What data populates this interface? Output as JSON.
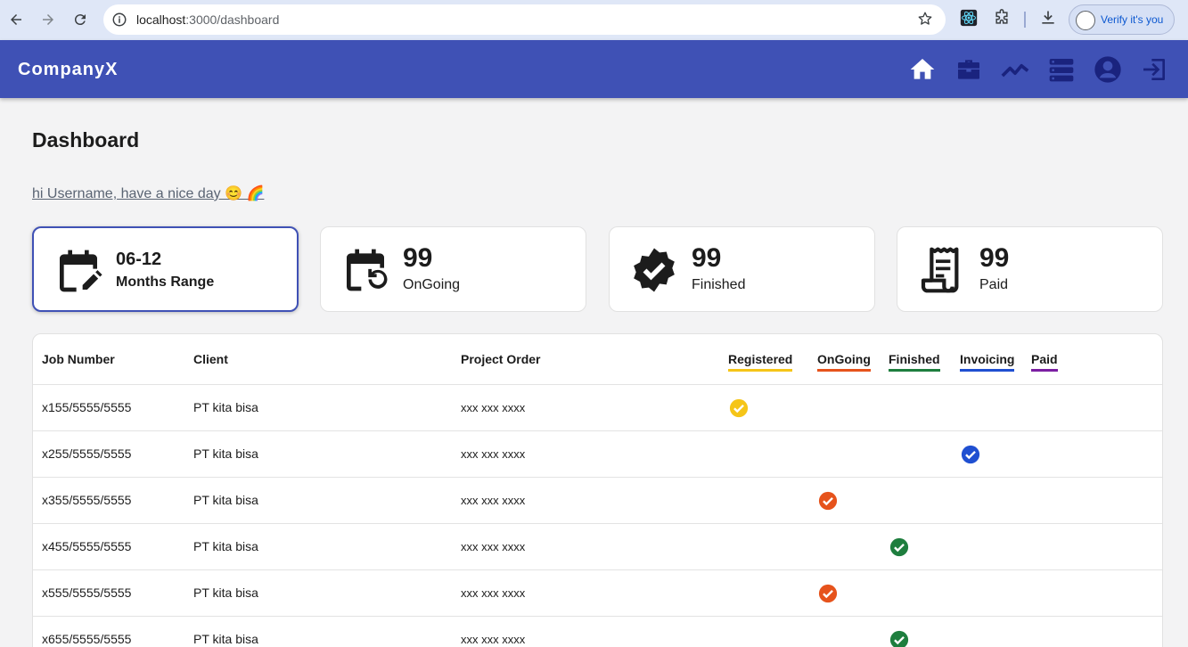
{
  "browser": {
    "url_host": "localhost",
    "url_path": ":3000/dashboard",
    "profile_label": "Verify it's you"
  },
  "appbar": {
    "brand": "CompanyX",
    "icons": [
      "home-icon",
      "briefcase-icon",
      "trending-icon",
      "list-icon",
      "account-icon",
      "logout-icon"
    ]
  },
  "page": {
    "title": "Dashboard",
    "greeting": "hi Username, have a nice day 😊 🌈"
  },
  "cards": [
    {
      "value": "06-12",
      "label": "Months Range",
      "icon": "calendar-edit-icon"
    },
    {
      "value": "99",
      "label": "OnGoing",
      "icon": "calendar-clock-icon"
    },
    {
      "value": "99",
      "label": "Finished",
      "icon": "verified-icon"
    },
    {
      "value": "99",
      "label": "Paid",
      "icon": "receipt-icon"
    }
  ],
  "table": {
    "headers": {
      "job": "Job Number",
      "client": "Client",
      "project": "Project Order"
    },
    "statuses": [
      {
        "label": "Registered",
        "color": "#f5c518"
      },
      {
        "label": "OnGoing",
        "color": "#e6531c"
      },
      {
        "label": "Finished",
        "color": "#1e7e3e"
      },
      {
        "label": "Invoicing",
        "color": "#1f4fd1"
      },
      {
        "label": "Paid",
        "color": "#7b1fa2"
      }
    ],
    "rows": [
      {
        "job": "x155/5555/5555",
        "client": "PT kita bisa",
        "project": "xxx xxx xxxx",
        "status": "Registered"
      },
      {
        "job": "x255/5555/5555",
        "client": "PT kita bisa",
        "project": "xxx xxx xxxx",
        "status": "Invoicing"
      },
      {
        "job": "x355/5555/5555",
        "client": "PT kita bisa",
        "project": "xxx xxx xxxx",
        "status": "OnGoing"
      },
      {
        "job": "x455/5555/5555",
        "client": "PT kita bisa",
        "project": "xxx xxx xxxx",
        "status": "Finished"
      },
      {
        "job": "x555/5555/5555",
        "client": "PT kita bisa",
        "project": "xxx xxx xxxx",
        "status": "OnGoing"
      },
      {
        "job": "x655/5555/5555",
        "client": "PT kita bisa",
        "project": "xxx xxx xxxx",
        "status": "Finished"
      }
    ]
  }
}
